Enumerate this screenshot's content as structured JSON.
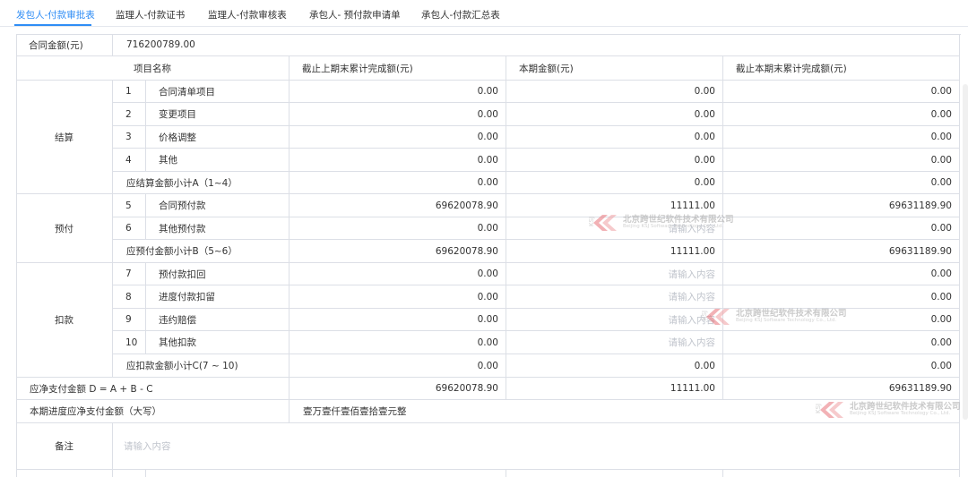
{
  "tabs": [
    {
      "label": "发包人-付款审批表",
      "active": true
    },
    {
      "label": "监理人-付款证书",
      "active": false
    },
    {
      "label": "监理人-付款审核表",
      "active": false
    },
    {
      "label": "承包人- 预付款申请单",
      "active": false
    },
    {
      "label": "承包人-付款汇总表",
      "active": false
    }
  ],
  "contract": {
    "label": "合同金额(元)",
    "value": "716200789.00"
  },
  "headers": {
    "item_name": "项目名称",
    "prev": "截止上期末累计完成额(元)",
    "current": "本期金额(元)",
    "cumulative": "截止本期末累计完成额(元)"
  },
  "groups": {
    "settlement": "结算",
    "prepay": "预付",
    "deduction": "扣款"
  },
  "rows": [
    {
      "no": "1",
      "name": "合同清单项目",
      "prev": "0.00",
      "current": "0.00",
      "cum": "0.00"
    },
    {
      "no": "2",
      "name": "变更项目",
      "prev": "0.00",
      "current": "0.00",
      "cum": "0.00"
    },
    {
      "no": "3",
      "name": "价格调整",
      "prev": "0.00",
      "current": "0.00",
      "cum": "0.00"
    },
    {
      "no": "4",
      "name": "其他",
      "prev": "0.00",
      "current": "0.00",
      "cum": "0.00"
    },
    {
      "subtotal": "应结算金额小计A（1~4）",
      "prev": "0.00",
      "current": "0.00",
      "cum": "0.00"
    },
    {
      "no": "5",
      "name": "合同预付款",
      "prev": "69620078.90",
      "current": "11111.00",
      "cum": "69631189.90"
    },
    {
      "no": "6",
      "name": "其他预付款",
      "prev": "0.00",
      "current": "请输入内容",
      "cum": "0.00"
    },
    {
      "subtotal": "应预付金额小计B（5~6）",
      "prev": "69620078.90",
      "current": "11111.00",
      "cum": "69631189.90"
    },
    {
      "no": "7",
      "name": "预付款扣回",
      "prev": "0.00",
      "current": "请输入内容",
      "cum": "0.00"
    },
    {
      "no": "8",
      "name": "进度付款扣留",
      "prev": "0.00",
      "current": "请输入内容",
      "cum": "0.00"
    },
    {
      "no": "9",
      "name": "违约赔偿",
      "prev": "0.00",
      "current": "请输入内容",
      "cum": "0.00"
    },
    {
      "no": "10",
      "name": "其他扣款",
      "prev": "0.00",
      "current": "请输入内容",
      "cum": "0.00"
    },
    {
      "subtotal": "应扣款金额小计C(7 ~ 10)",
      "prev": "0.00",
      "current": "0.00",
      "cum": "0.00"
    }
  ],
  "net": {
    "label": "应净支付金额 D = A + B - C",
    "prev": "69620078.90",
    "current": "11111.00",
    "cum": "69631189.90"
  },
  "capital": {
    "label": "本期进度应净支付金额（大写）",
    "value": "壹万壹仟壹佰壹拾壹元整"
  },
  "remarks": {
    "label": "备注",
    "placeholder": "请输入内容"
  },
  "watermark": {
    "cn": "北京跨世纪软件技术有限公司",
    "en": "Beijing KSJ Software Technology Co., Ltd."
  },
  "colors": {
    "accent": "#2f8df5",
    "border": "#dcdfe6",
    "placeholder": "#c0c4cc",
    "watermark": "#e8737a"
  }
}
